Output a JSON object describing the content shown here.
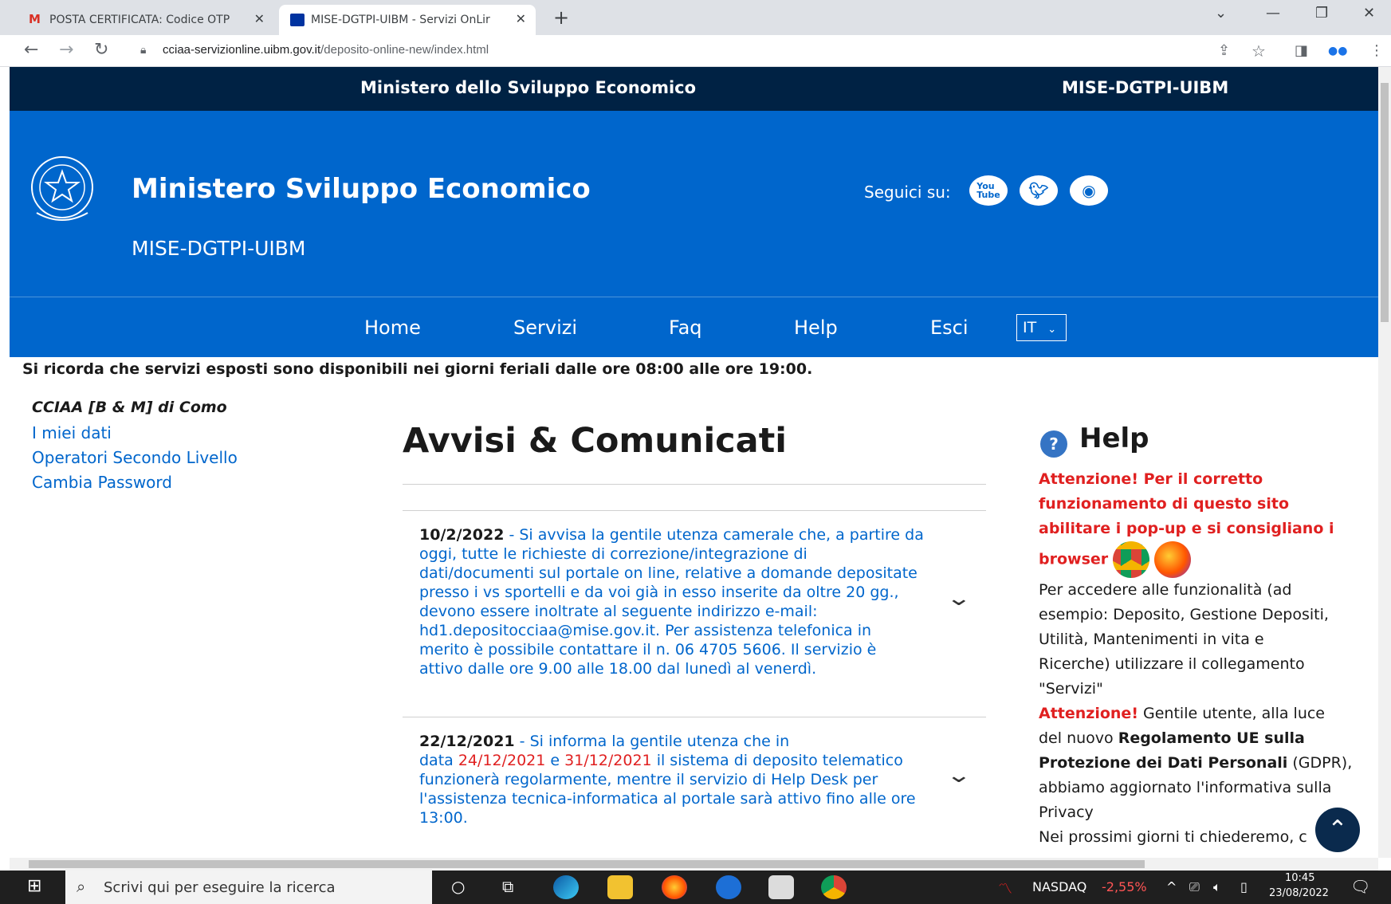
{
  "browser": {
    "tabs": [
      {
        "label": "POSTA CERTIFICATA: Codice OTP",
        "active": false
      },
      {
        "label": "MISE-DGTPI-UIBM - Servizi OnLir",
        "active": true
      }
    ],
    "new_tab": "+",
    "url_host": "cciaa-servizionline.uibm.gov.it",
    "url_path": "/deposito-online-new/index.html"
  },
  "ribbon": {
    "left": "Ministero dello Sviluppo Economico",
    "right": "MISE-DGTPI-UIBM"
  },
  "header": {
    "title": "Ministero Sviluppo Economico",
    "subtitle": "MISE-DGTPI-UIBM",
    "follow_label": "Seguici su:",
    "social": [
      "youtube-icon",
      "twitter-icon",
      "rss-icon"
    ]
  },
  "menu": {
    "items": [
      "Home",
      "Servizi",
      "Faq",
      "Help",
      "Esci"
    ],
    "language": "IT"
  },
  "notice": "Si ricorda che servizi esposti sono disponibili nei giorni feriali dalle ore 08:00 alle ore 19:00.",
  "sidebar": {
    "title": "CCIAA [B & M] di Como",
    "links": [
      "I miei dati",
      "Operatori Secondo Livello",
      "Cambia Password"
    ]
  },
  "main": {
    "heading": "Avvisi & Comunicati",
    "news": [
      {
        "date": "10/2/2022",
        "lines": [
          " - Si avvisa la gentile utenza camerale che, a partire da",
          "oggi, tutte le richieste di correzione/integrazione di",
          "dati/documenti sul portale on line, relative a domande depositate",
          "presso i vs sportelli e da voi già in esso inserite da oltre 20 gg.,",
          "devono essere inoltrate al seguente indirizzo e-mail:",
          "hd1.depositocciaa@mise.gov.it. Per assistenza telefonica in",
          "merito è possibile contattare il n. 06 4705 5606. Il servizio è",
          "attivo dalle ore 9.00 alle 18.00 dal lunedì al venerdì."
        ]
      },
      {
        "date": "22/12/2021",
        "line1": " - Si informa la gentile utenza che in",
        "line2_a": "data ",
        "line2_red1": "24/12/2021",
        "line2_b": " e ",
        "line2_red2": "31/12/2021",
        "line2_c": " il sistema di deposito telematico",
        "line3": "funzionerà regolarmente, mentre il servizio di Help Desk per",
        "line4": "l'assistenza tecnica-informatica al portale sarà attivo fino alle ore",
        "line5": "13:00."
      }
    ]
  },
  "help": {
    "title": "Help",
    "warn_lines": [
      "Attenzione! Per il corretto",
      "funzionamento di questo sito",
      "abilitare i pop-up e si consigliano i",
      "browser"
    ],
    "p1": [
      "Per accedere alle funzionalità (ad",
      "esempio: Deposito, Gestione Depositi,",
      "Utilità, Mantenimenti in vita e",
      "Ricerche) utilizzare il collegamento",
      "\"Servizi\""
    ],
    "p2_red": "Attenzione!",
    "p2_a": " Gentile utente, alla luce",
    "p2_b": "del nuovo ",
    "p2_bold1": "Regolamento UE sulla",
    "p2_bold2": "Protezione dei Dati Personali",
    "p2_c": " (GDPR),",
    "p2_d": "abbiamo aggiornato l'informativa sulla",
    "p2_e": "Privacy",
    "p3": "Nei prossimi giorni ti chiederemo, c"
  },
  "taskbar": {
    "search_placeholder": "Scrivi qui per eseguire la ricerca",
    "ticker_name": "NASDAQ",
    "ticker_value": "-2,55%",
    "time": "10:45",
    "date": "23/08/2022"
  },
  "colors": {
    "primary": "#0066cc",
    "dark": "#002244",
    "alert": "#e02020"
  }
}
